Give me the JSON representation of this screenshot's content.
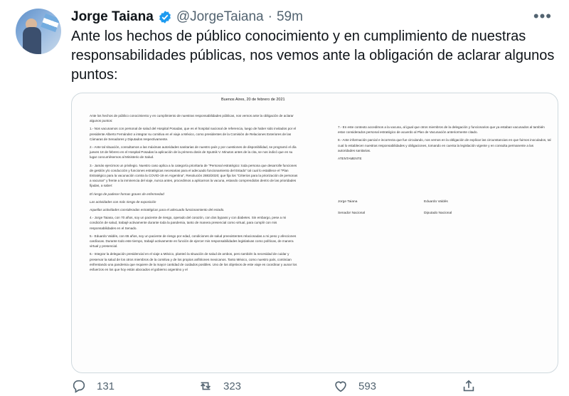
{
  "tweet": {
    "author_name": "Jorge Taiana",
    "handle": "@JorgeTaiana",
    "separator": "·",
    "time": "59m",
    "text": "Ante los hechos de público conocimiento y en cumplimiento de nuestras responsabilidades públicas, nos vemos ante la obligación de aclarar algunos puntos:",
    "more_label": "•••"
  },
  "document": {
    "date": "Buenos Aires, 20 de febrero de 2021",
    "left_paragraphs": [
      "Ante los hechos de público conocimiento y en cumplimiento de nuestras responsabilidades públicas, nos vemos ante la obligación de aclarar algunos puntos:",
      "1.- Nos vacunamos con personal de salud del Hospital Posadas, que es el hospital nacional de referencia, luego de haber sido invitados por el presidente Alberto Fernández a integrar su comitiva en el viaje a México, como presidentes de la Comisión de Relaciones Exteriores de las Cámaras de Senadores y Diputados respectivamente.",
      "2.- Ante tal situación, consultamos a las máximas autoridades sanitarias de nuestro país y por cuestiones de disponibilidad, se programó el día jueves 18 de febrero en el Hospital Posadas la aplicación de la primera dosis de Sputnik V. Minutos antes de la cita, se nos indicó que en su lugar concurriésemos al Ministerio de Salud.",
      "3.- Jamás ejercimos un privilegio. Nuestro caso aplica a la categoría prioritaria de \"Personal estratégico: toda persona que desarrolle funciones de gestión y/o conducción y funciones estratégicas necesarias para el adecuado funcionamiento del Estado\" tal cual lo establece el \"Plan Estratégico para la vacunación contra la COVID-19 en Argentina\", Resolución 2883/2020; que fija los \"Criterios para la priorización de personas a vacunar\" y frente a la inminencia del viaje, nunca antes, procedimos a aplicarnos la vacuna, estando comprendidos dentro de las prioridades fijadas, a saber:",
      "4.- Jorge Taiana, con 70 años, soy un paciente de riesgo, operado del corazón, con dos bypass y con diabetes. Sin embargo, pese a mi condición de salud, trabajé activamente durante toda la pandemia, tanto de manera presencial como virtual, para cumplir con mis responsabilidades en el Senado.",
      "5.- Eduardo Valdés, con 65 años, soy un paciente de riesgo por edad, condiciones de salud preexistentes relacionadas a mi peso y afecciones cardíacas. Durante todo este tiempo, trabajé activamente en función de ejercer mis responsabilidades legislativas como políticas, de manera virtual y presencial.",
      "6.- Integrar la delegación presidencial en el viaje a México, planteó la situación de salud de ambos, pero también la necesidad de cuidar y preservar la salud de los otros miembros de la comitiva y de los propios anfitriones mexicanos. Tanto México, como nuestro país, continúan enfrentando una pandemia que requiere de la mayor cantidad de cuidados posibles. Uno de los objetivos de este viaje es coordinar y aunar los esfuerzos en los que hoy están abocados el gobierno argentino y el"
    ],
    "bullets": [
      "El riesgo de padecer formas graves de enfermedad",
      "Las actividades con más riesgo de exposición",
      "Aquellas actividades consideradas estratégicas para el adecuado funcionamiento del estado."
    ],
    "right_paragraphs": [
      "7.- En este contexto accedimos a la vacuna, al igual que otros miembros de la delegación y funcionarios que ya estaban vacunados al también estar considerados personal estratégico de acuerdo al Plan de Vacunación anteriormente citado.",
      "8.- Ante información parcial e incorrecta que fue circulando, nos vemos en la obligación de explicar las circunstancias en que fuimos inoculados, tal cual lo establecen nuestras responsabilidades y obligaciones, tomando en cuenta la legislación vigente y en consulta permanente a las autoridades sanitarias.",
      "ATENTAMENTE"
    ],
    "signatures": [
      {
        "name": "Jorge Taiana",
        "role": "Senador Nacional"
      },
      {
        "name": "Eduardo Valdés",
        "role": "Diputado Nacional"
      }
    ]
  },
  "actions": {
    "reply_count": "131",
    "retweet_count": "323",
    "like_count": "593"
  },
  "colors": {
    "verified": "#1d9bf0",
    "secondary": "#536471"
  }
}
